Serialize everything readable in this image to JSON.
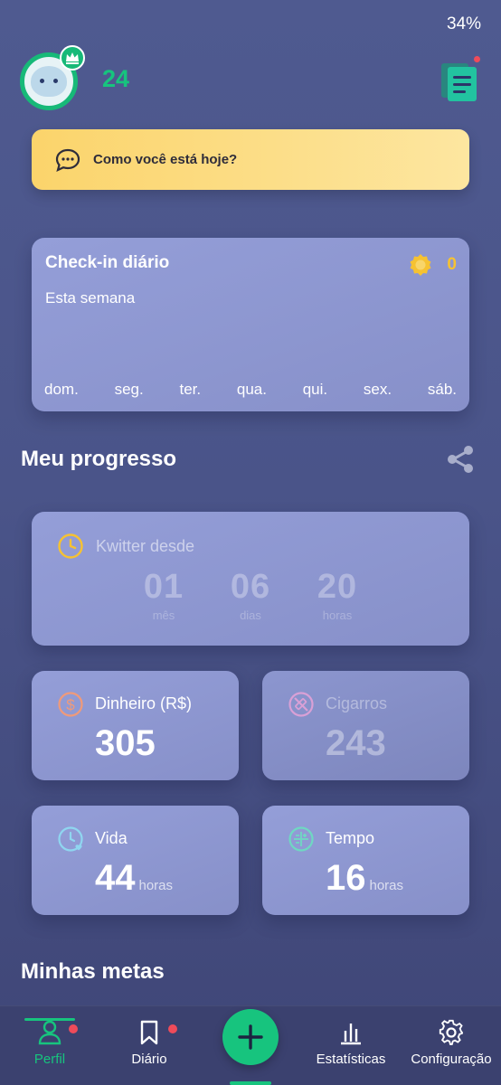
{
  "status_bar": {
    "battery": "34%"
  },
  "header": {
    "level": "24"
  },
  "mood_prompt": {
    "text": "Como você está hoje?"
  },
  "checkin": {
    "title": "Check-in diário",
    "coins": "0",
    "subtitle": "Esta semana",
    "days": [
      "dom.",
      "seg.",
      "ter.",
      "qua.",
      "qui.",
      "sex.",
      "sáb."
    ]
  },
  "progress": {
    "title": "Meu progresso",
    "kwitter": {
      "label": "Kwitter desde",
      "counters": [
        {
          "value": "01",
          "unit": "mês"
        },
        {
          "value": "06",
          "unit": "dias"
        },
        {
          "value": "20",
          "unit": "horas"
        }
      ]
    },
    "stats": {
      "money": {
        "label": "Dinheiro (R$)",
        "value": "305"
      },
      "cigarettes": {
        "label": "Cigarros",
        "value": "243"
      },
      "life": {
        "label": "Vida",
        "value": "44",
        "unit": "horas"
      },
      "time": {
        "label": "Tempo",
        "value": "16",
        "unit": "horas"
      }
    }
  },
  "goals": {
    "title": "Minhas metas"
  },
  "tabbar": {
    "profile": "Perfil",
    "diary": "Diário",
    "stats": "Estatísticas",
    "settings": "Configuração"
  },
  "colors": {
    "accent_green": "#17c47e",
    "mood_yellow": "#fbd46b",
    "coin_gold": "#f6c232",
    "notification_red": "#ef4b5a"
  }
}
